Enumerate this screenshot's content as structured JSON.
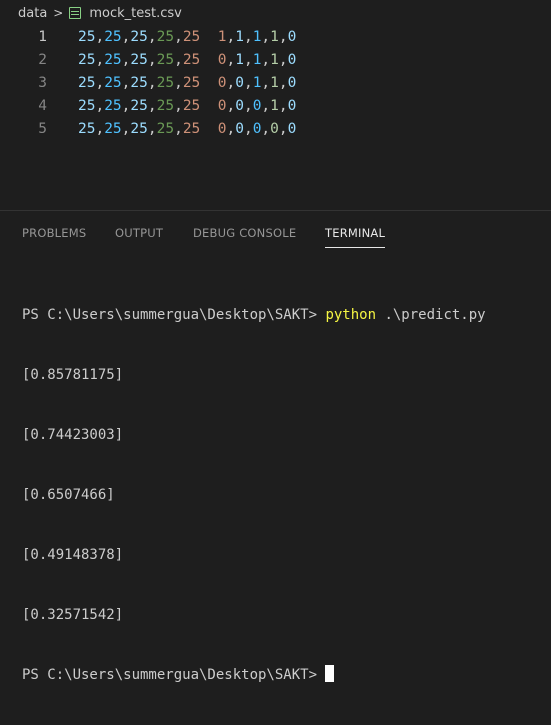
{
  "breadcrumb": {
    "folder": "data",
    "separator": ">",
    "file_icon": "csv-file-icon",
    "file": "mock_test.csv"
  },
  "editor": {
    "lines": [
      {
        "number": "1",
        "fields": [
          "25",
          "25",
          "25",
          "25",
          "25",
          "1",
          "1",
          "1",
          "1",
          "0"
        ]
      },
      {
        "number": "2",
        "fields": [
          "25",
          "25",
          "25",
          "25",
          "25",
          "0",
          "1",
          "1",
          "1",
          "0"
        ]
      },
      {
        "number": "3",
        "fields": [
          "25",
          "25",
          "25",
          "25",
          "25",
          "0",
          "0",
          "1",
          "1",
          "0"
        ]
      },
      {
        "number": "4",
        "fields": [
          "25",
          "25",
          "25",
          "25",
          "25",
          "0",
          "0",
          "0",
          "1",
          "0"
        ]
      },
      {
        "number": "5",
        "fields": [
          "25",
          "25",
          "25",
          "25",
          "25",
          "0",
          "0",
          "0",
          "0",
          "0"
        ]
      }
    ],
    "column_colors": [
      "#9cdcfe",
      "#4fc1ff",
      "#9cdcfe",
      "#6a9955",
      "#ce9178",
      "#ce9178",
      "#9cdcfe",
      "#4fc1ff",
      "#b5cea8",
      "#9cdcfe"
    ]
  },
  "panel": {
    "tabs": [
      {
        "label": "PROBLEMS",
        "active": false
      },
      {
        "label": "OUTPUT",
        "active": false
      },
      {
        "label": "DEBUG CONSOLE",
        "active": false
      },
      {
        "label": "TERMINAL",
        "active": true
      }
    ]
  },
  "terminal": {
    "prompt": "PS C:\\Users\\summergua\\Desktop\\SAKT> ",
    "command": "python",
    "args": " .\\predict.py",
    "output": [
      "[0.85781175]",
      "[0.74423003]",
      "[0.6507466]",
      "[0.49148378]",
      "[0.32571542]"
    ],
    "final_prompt": "PS C:\\Users\\summergua\\Desktop\\SAKT>"
  }
}
